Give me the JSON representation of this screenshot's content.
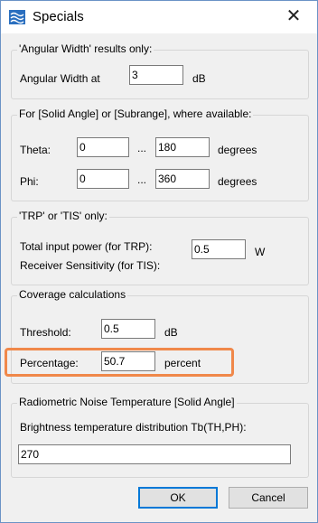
{
  "window": {
    "title": "Specials",
    "close_glyph": "✕"
  },
  "angular": {
    "legend": "'Angular Width' results only:",
    "label": "Angular Width at",
    "value": "3",
    "unit": "dB"
  },
  "solid_angle": {
    "legend": "For [Solid Angle] or [Subrange], where available:",
    "theta_label": "Theta:",
    "theta_from": "0",
    "theta_to": "180",
    "phi_label": "Phi:",
    "phi_from": "0",
    "phi_to": "360",
    "range_sep": "...",
    "unit": "degrees"
  },
  "trp": {
    "legend": "'TRP' or 'TIS' only:",
    "trp_label": "Total input power (for TRP):",
    "tis_label": "Receiver Sensitivity (for TIS):",
    "value": "0.5",
    "unit": "W"
  },
  "coverage": {
    "legend": "Coverage calculations",
    "threshold_label": "Threshold:",
    "threshold_value": "0.5",
    "threshold_unit": "dB",
    "percentage_label": "Percentage:",
    "percentage_value": "50.7",
    "percentage_unit": "percent"
  },
  "noise": {
    "legend": "Radiometric Noise Temperature [Solid Angle]",
    "label": "Brightness temperature distribution Tb(TH,PH):",
    "value": "270"
  },
  "buttons": {
    "ok": "OK",
    "cancel": "Cancel"
  },
  "colors": {
    "highlight": "#f0884a",
    "accent": "#0078d7"
  },
  "icons": {
    "app": "wave-icon",
    "close": "close-icon"
  }
}
